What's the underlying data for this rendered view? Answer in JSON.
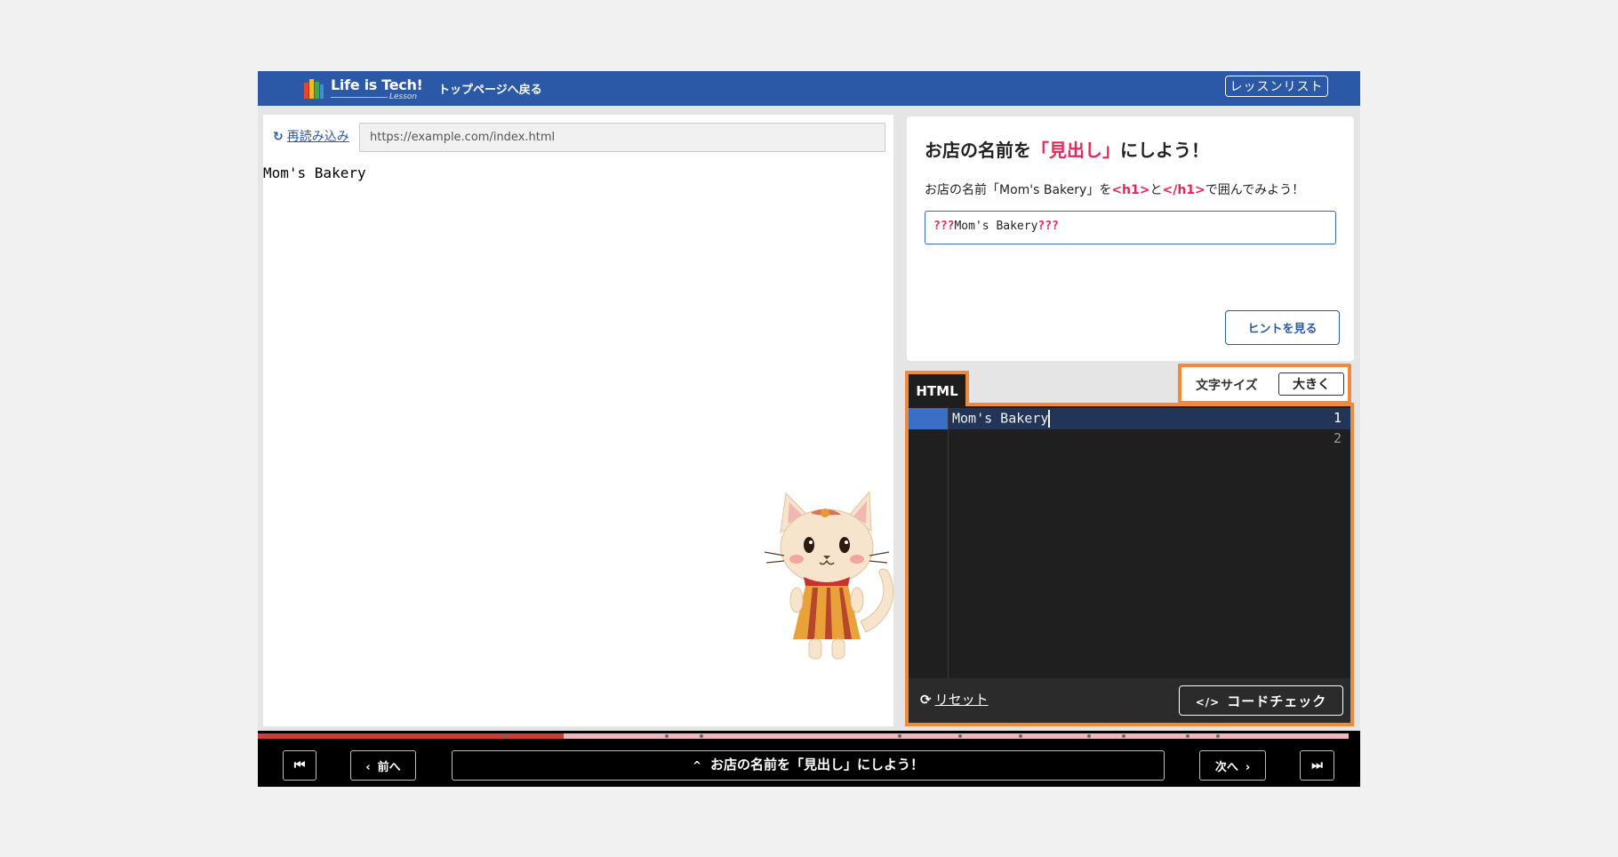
{
  "header": {
    "logo_text": "Life is Tech!",
    "logo_sub": "Lesson",
    "back_link": "トップページへ戻る",
    "lesson_list_button": "レッスンリスト"
  },
  "preview": {
    "reload_label": "再読み込み",
    "url": "https://example.com/index.html",
    "content_text": "Mom's Bakery"
  },
  "task": {
    "title_prefix": "お店の名前を",
    "title_highlight": "「見出し」",
    "title_suffix": "にしよう！",
    "desc_prefix": "お店の名前「Mom's Bakery」を",
    "desc_open_tag": "<h1>",
    "desc_mid": "と",
    "desc_close_tag": "</h1>",
    "desc_suffix": "で囲んでみよう！",
    "answer_open": "???",
    "answer_text": "Mom's Bakery",
    "answer_close": "???",
    "hint_button": "ヒントを見る"
  },
  "editor": {
    "tab_label": "HTML",
    "font_size_label": "文字サイズ",
    "font_size_button": "大きく",
    "line_numbers": [
      "1",
      "2"
    ],
    "lines": [
      "Mom's Bakery",
      ""
    ],
    "reset_label": "リセット",
    "code_check_label": "コードチェック",
    "code_check_icon": "</>"
  },
  "progress": {
    "fraction": 0.28
  },
  "bottom_nav": {
    "first_icon": "skip-back-icon",
    "prev_label": "前へ",
    "center_label": "お店の名前を「見出し」にしよう！",
    "next_label": "次へ",
    "last_icon": "skip-forward-icon"
  },
  "colors": {
    "brand_blue": "#2c58a8",
    "highlight_pink": "#e3285a",
    "focus_orange": "#f08a3c",
    "progress_red": "#cf3c36"
  }
}
